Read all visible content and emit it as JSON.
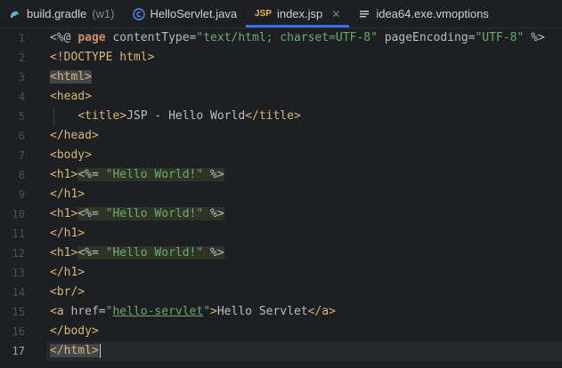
{
  "tabs": [
    {
      "label": "build.gradle",
      "suffix": "(w1)",
      "icon": "gradle-icon",
      "active": false
    },
    {
      "label": "HelloServlet.java",
      "icon": "java-class-icon",
      "active": false
    },
    {
      "label": "index.jsp",
      "icon": "jsp-icon",
      "icon_text": "JSP",
      "active": true
    },
    {
      "label": "idea64.exe.vmoptions",
      "icon": "text-file-icon",
      "active": false
    }
  ],
  "line_numbers": [
    "1",
    "2",
    "3",
    "4",
    "5",
    "6",
    "7",
    "8",
    "9",
    "10",
    "11",
    "12",
    "13",
    "14",
    "15",
    "16",
    "17"
  ],
  "current_line": "17",
  "code": {
    "l1": {
      "open": "<%@ ",
      "kw": "page",
      "sp1": " ",
      "a1": "contentType",
      "eq1": "=",
      "v1": "\"text/html; charset=UTF-8\"",
      "sp2": " ",
      "a2": "pageEncoding",
      "eq2": "=",
      "v2": "\"UTF-8\"",
      "close": " %>"
    },
    "l2": "<!DOCTYPE html>",
    "l3": "<html>",
    "l4": "<head>",
    "l5": {
      "indent": "    ",
      "open": "<title>",
      "text": "JSP - Hello World",
      "close": "</title>"
    },
    "l6": "</head>",
    "l7": "<body>",
    "l8": {
      "tag": "<h1>",
      "expr_open": "<%= ",
      "str": "\"Hello World!\"",
      "expr_close": " %>"
    },
    "l9": "</h1>",
    "l10": {
      "tag": "<h1>",
      "expr_open": "<%= ",
      "str": "\"Hello World!\"",
      "expr_close": " %>"
    },
    "l11": "</h1>",
    "l12": {
      "tag": "<h1>",
      "expr_open": "<%= ",
      "str": "\"Hello World!\"",
      "expr_close": " %>"
    },
    "l13": "</h1>",
    "l14": "<br/>",
    "l15": {
      "open": "<a ",
      "attr": "href",
      "eq": "=",
      "q1": "\"",
      "link": "hello-servlet",
      "q2": "\"",
      "gt": ">",
      "text": "Hello Servlet",
      "close": "</a>"
    },
    "l16": "</body>",
    "l17": "</html>"
  }
}
